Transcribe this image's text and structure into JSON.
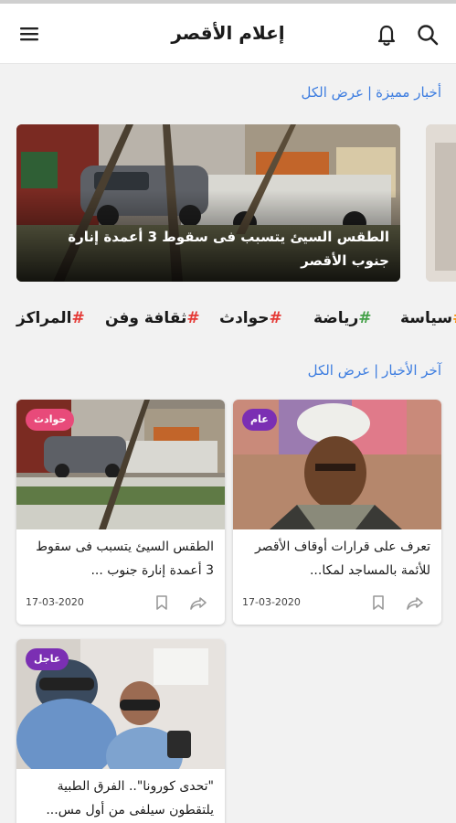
{
  "app": {
    "title": "إعلام الأقصر"
  },
  "icons": {
    "menu": "menu-icon",
    "notifications": "bell-icon",
    "search": "search-icon",
    "bookmark": "bookmark-icon",
    "share": "share-icon"
  },
  "featured_section": {
    "title": "أخبار مميزة",
    "separator": "|",
    "view_all": "عرض الكل"
  },
  "featured": {
    "caption": "الطقس السيئ يتسبب فى سقوط 3 أعمدة إنارة جنوب الأقصر"
  },
  "categories": [
    {
      "hash": "#",
      "label": "المراكز",
      "color": "#e53935"
    },
    {
      "hash": "#",
      "label": "ثقافة وفن",
      "color": "#e53935"
    },
    {
      "hash": "#",
      "label": "حوادث",
      "color": "#e53935"
    },
    {
      "hash": "#",
      "label": "رياضة",
      "color": "#43a047"
    },
    {
      "hash": "#",
      "label": "سياسة",
      "color": "#fb8c00"
    }
  ],
  "latest_section": {
    "title": "آخر الأخبار",
    "separator": "|",
    "view_all": "عرض الكل"
  },
  "cards": [
    {
      "badge": "عام",
      "badge_color": "#7b2fb3",
      "title": "تعرف على قرارات أوقاف الأقصر للأئمة بالمساجد لمكا...",
      "date": "17-03-2020"
    },
    {
      "badge": "حوادث",
      "badge_color": "#e84a7a",
      "title": "الطقس السيئ يتسبب فى سقوط 3 أعمدة إنارة جنوب ...",
      "date": "17-03-2020"
    },
    {
      "badge": "عاجل",
      "badge_color": "#7b2fb3",
      "title": "\"تحدى كورونا\".. الفرق الطبية يلتقطون سيلفى من أول مس...",
      "date": ""
    }
  ]
}
